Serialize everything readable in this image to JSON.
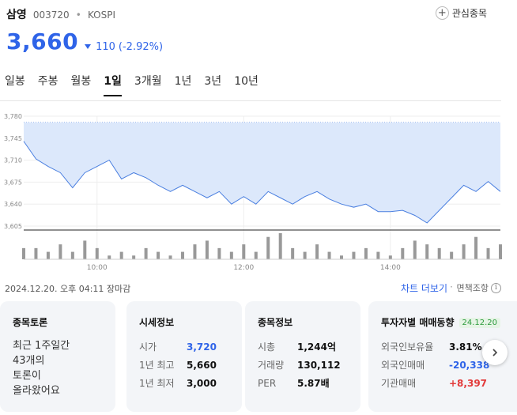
{
  "stock": {
    "name": "삼영",
    "code": "003720",
    "market": "KOSPI",
    "price": "3,660",
    "change_amount": "110",
    "change_pct": "(-2.92%)",
    "direction": "down"
  },
  "watchlist": {
    "label": "관심종목",
    "icon": "plus-circle-icon"
  },
  "tabs": [
    {
      "label": "일봉",
      "active": false
    },
    {
      "label": "주봉",
      "active": false
    },
    {
      "label": "월봉",
      "active": false
    },
    {
      "label": "1일",
      "active": true
    },
    {
      "label": "3개월",
      "active": false
    },
    {
      "label": "1년",
      "active": false
    },
    {
      "label": "3년",
      "active": false
    },
    {
      "label": "10년",
      "active": false
    }
  ],
  "colors": {
    "accent_blue": "#2f64e8",
    "down": "#2f64e8",
    "up": "#e23a3a",
    "area_fill": "#dce8fb",
    "line": "#4a7fe0",
    "volume_bar": "#999999"
  },
  "chart_data": {
    "type": "area",
    "y_ticks": [
      "3,780",
      "3,745",
      "3,710",
      "3,675",
      "3,640",
      "3,605"
    ],
    "ylim": [
      3605,
      3780
    ],
    "x_ticks": [
      "10:00",
      "12:00",
      "14:00"
    ],
    "reference_price": 3770,
    "x": [
      "09:00",
      "09:10",
      "09:20",
      "09:30",
      "09:40",
      "09:50",
      "10:00",
      "10:10",
      "10:20",
      "10:30",
      "10:40",
      "10:50",
      "11:00",
      "11:10",
      "11:20",
      "11:30",
      "11:40",
      "11:50",
      "12:00",
      "12:10",
      "12:20",
      "12:30",
      "12:40",
      "12:50",
      "13:00",
      "13:10",
      "13:20",
      "13:30",
      "13:40",
      "13:50",
      "14:00",
      "14:10",
      "14:20",
      "14:30",
      "14:40",
      "14:50",
      "15:00",
      "15:10",
      "15:20",
      "15:30"
    ],
    "values": [
      3740,
      3712,
      3700,
      3690,
      3666,
      3690,
      3700,
      3710,
      3680,
      3690,
      3682,
      3670,
      3660,
      3670,
      3660,
      3650,
      3660,
      3640,
      3652,
      3640,
      3660,
      3650,
      3640,
      3652,
      3660,
      3648,
      3640,
      3635,
      3640,
      3628,
      3628,
      3630,
      3622,
      3610,
      3630,
      3650,
      3670,
      3660,
      3676,
      3660
    ],
    "volume": [
      3,
      3,
      2,
      4,
      2,
      5,
      3,
      1,
      2,
      1,
      3,
      2,
      1,
      2,
      4,
      5,
      3,
      2,
      4,
      2,
      6,
      7,
      3,
      2,
      4,
      2,
      1,
      2,
      3,
      2,
      1,
      3,
      5,
      4,
      3,
      2,
      4,
      6,
      3,
      4
    ],
    "grid": true
  },
  "footer": {
    "timestamp": "2024.12.20. 오후 04:11 장마감",
    "chart_more": "차트 더보기",
    "separator": "·",
    "disclaimer": "면책조항"
  },
  "cards": {
    "discussion": {
      "title": "종목토론",
      "line1": "최근 1주일간",
      "line2": "43개의",
      "line3": "토론이",
      "line4": "올라왔어요"
    },
    "market": {
      "title": "시세정보",
      "rows": [
        {
          "label": "시가",
          "value": "3,720"
        },
        {
          "label": "1년 최고",
          "value": "5,660"
        },
        {
          "label": "1년 최저",
          "value": "3,000"
        }
      ]
    },
    "info": {
      "title": "종목정보",
      "rows": [
        {
          "label": "시총",
          "value": "1,244억"
        },
        {
          "label": "거래량",
          "value": "130,112"
        },
        {
          "label": "PER",
          "value": "5.87배"
        }
      ]
    },
    "investor": {
      "title": "투자자별 매매동향",
      "date": "24.12.20",
      "rows": [
        {
          "label": "외국인보유율",
          "value": "3.81%"
        },
        {
          "label": "외국인매매",
          "value": "-20,338"
        },
        {
          "label": "기관매매",
          "value": "+8,397"
        }
      ]
    }
  }
}
